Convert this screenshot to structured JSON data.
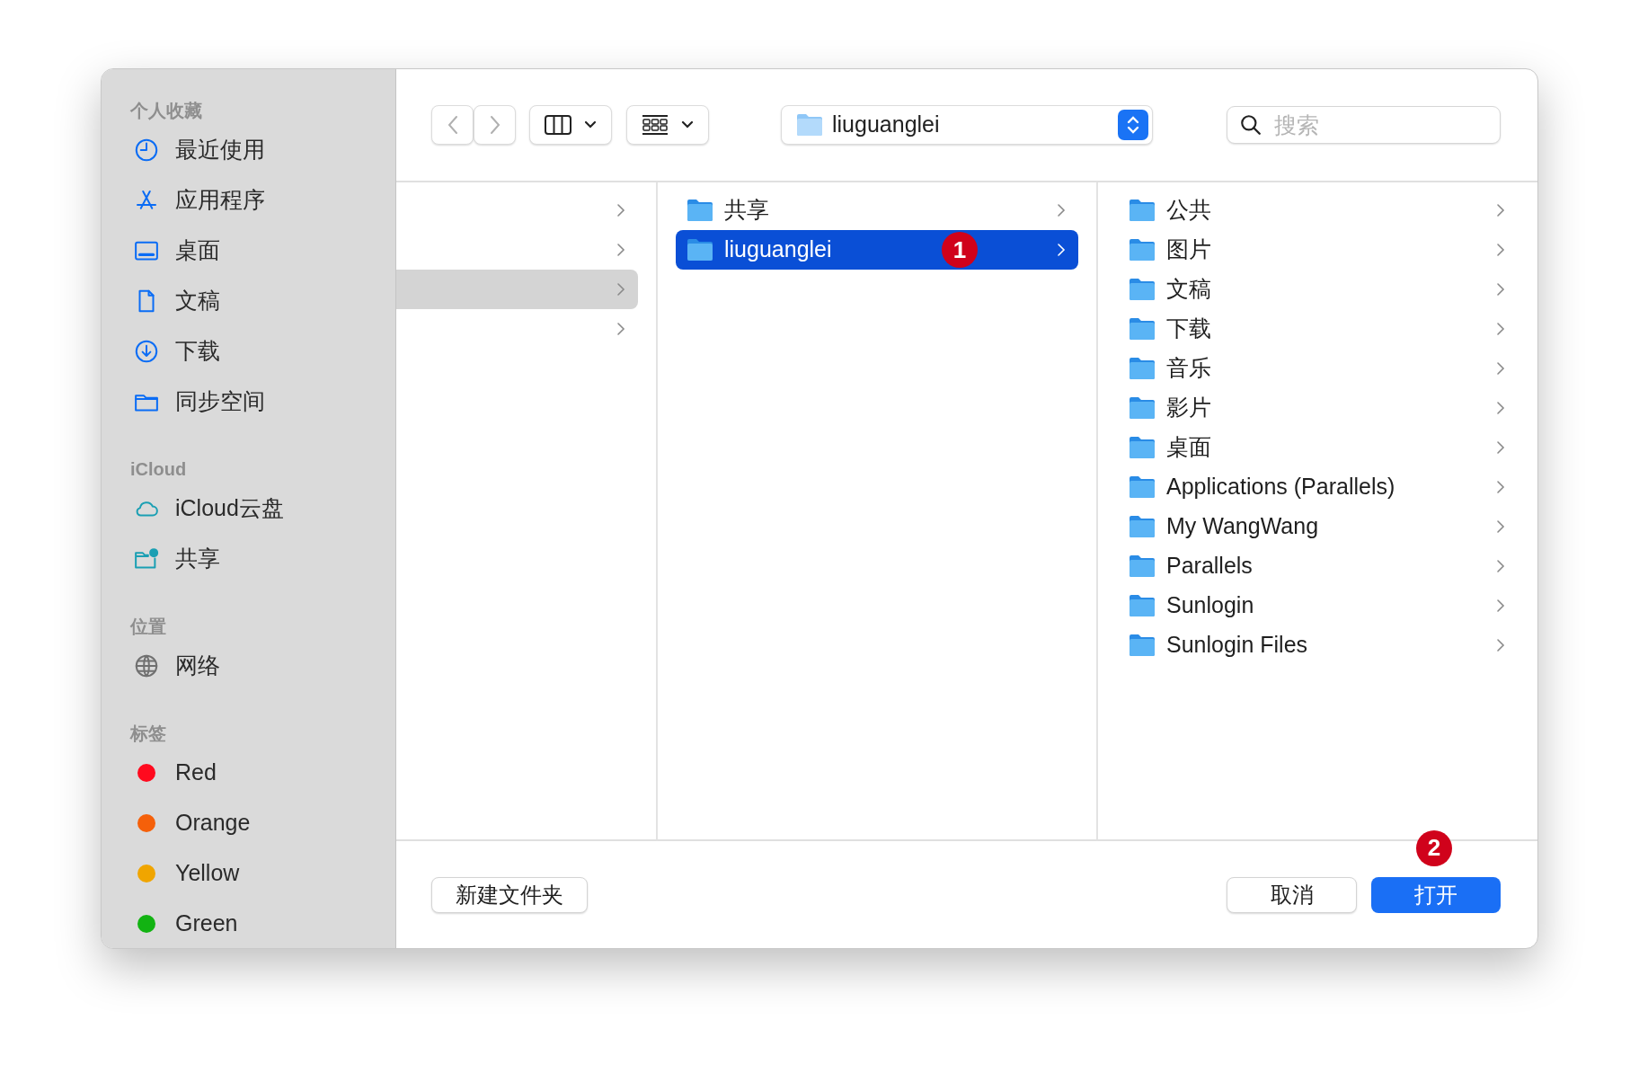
{
  "sidebar": {
    "sections": [
      {
        "title": "个人收藏",
        "items": [
          {
            "label": "最近使用"
          },
          {
            "label": "应用程序"
          },
          {
            "label": "桌面"
          },
          {
            "label": "文稿"
          },
          {
            "label": "下载"
          },
          {
            "label": "同步空间"
          }
        ]
      },
      {
        "title": "iCloud",
        "items": [
          {
            "label": "iCloud云盘"
          },
          {
            "label": "共享"
          }
        ]
      },
      {
        "title": "位置",
        "items": [
          {
            "label": "网络"
          }
        ]
      },
      {
        "title": "标签",
        "items": [
          {
            "label": "Red",
            "color": "#ff0a1e"
          },
          {
            "label": "Orange",
            "color": "#f5600a"
          },
          {
            "label": "Yellow",
            "color": "#f0a500"
          },
          {
            "label": "Green",
            "color": "#12b312"
          }
        ]
      }
    ]
  },
  "toolbar": {
    "path": "liuguanglei",
    "search": {
      "placeholder": "搜索"
    }
  },
  "columns": [
    {
      "rows": [
        {
          "selected": false
        },
        {
          "selected": false
        },
        {
          "selected": true
        },
        {
          "selected": false
        }
      ]
    },
    {
      "rows": [
        {
          "label": "共享",
          "selected": false
        },
        {
          "label": "liuguanglei",
          "selected": true,
          "badge": "1"
        }
      ]
    },
    {
      "rows": [
        {
          "label": "公共",
          "selected": false
        },
        {
          "label": "图片",
          "selected": false
        },
        {
          "label": "文稿",
          "selected": false
        },
        {
          "label": "下载",
          "selected": false
        },
        {
          "label": "音乐",
          "selected": false
        },
        {
          "label": "影片",
          "selected": false
        },
        {
          "label": "桌面",
          "selected": false
        },
        {
          "label": "Applications (Parallels)",
          "selected": false
        },
        {
          "label": "My WangWang",
          "selected": false
        },
        {
          "label": "Parallels",
          "selected": false
        },
        {
          "label": "Sunlogin",
          "selected": false
        },
        {
          "label": "Sunlogin Files",
          "selected": false
        }
      ]
    }
  ],
  "footer": {
    "new_folder": "新建文件夹",
    "cancel": "取消",
    "open": "打开",
    "open_badge": "2"
  }
}
